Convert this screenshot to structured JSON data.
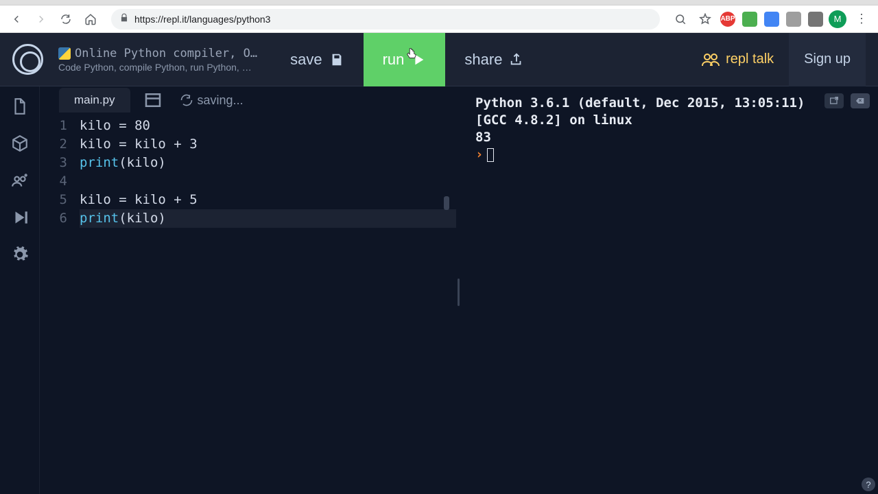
{
  "browser": {
    "url": "https://repl.it/languages/python3",
    "avatar_initial": "M",
    "ext_abp": "ABP"
  },
  "header": {
    "page_title": "Online Python compiler, O…",
    "page_subtitle": "Code Python, compile Python, run Python, …",
    "save_label": "save",
    "run_label": "run",
    "share_label": "share",
    "repl_talk_label": "repl talk",
    "signup_label": "Sign up"
  },
  "tabs": {
    "filename": "main.py",
    "saving_label": "saving..."
  },
  "code": {
    "lines": [
      {
        "n": "1",
        "tokens": [
          [
            "var",
            "kilo"
          ],
          [
            "op",
            " = "
          ],
          [
            "num",
            "80"
          ]
        ]
      },
      {
        "n": "2",
        "tokens": [
          [
            "var",
            "kilo"
          ],
          [
            "op",
            " = "
          ],
          [
            "var",
            "kilo"
          ],
          [
            "op",
            " + "
          ],
          [
            "num",
            "3"
          ]
        ]
      },
      {
        "n": "3",
        "tokens": [
          [
            "fn",
            "print"
          ],
          [
            "punc",
            "("
          ],
          [
            "var",
            "kilo"
          ],
          [
            "punc",
            ")"
          ]
        ]
      },
      {
        "n": "4",
        "tokens": []
      },
      {
        "n": "5",
        "tokens": [
          [
            "var",
            "kilo"
          ],
          [
            "op",
            " = "
          ],
          [
            "var",
            "kilo"
          ],
          [
            "op",
            " + "
          ],
          [
            "num",
            "5"
          ]
        ]
      },
      {
        "n": "6",
        "active": true,
        "tokens": [
          [
            "fn",
            "print"
          ],
          [
            "punc",
            "("
          ],
          [
            "var",
            "kilo"
          ],
          [
            "punc",
            ")"
          ]
        ]
      }
    ]
  },
  "terminal": {
    "lines": [
      "Python 3.6.1 (default, Dec 2015, 13:05:11)",
      "[GCC 4.8.2] on linux",
      "83"
    ],
    "prompt": "›"
  },
  "help": "?"
}
